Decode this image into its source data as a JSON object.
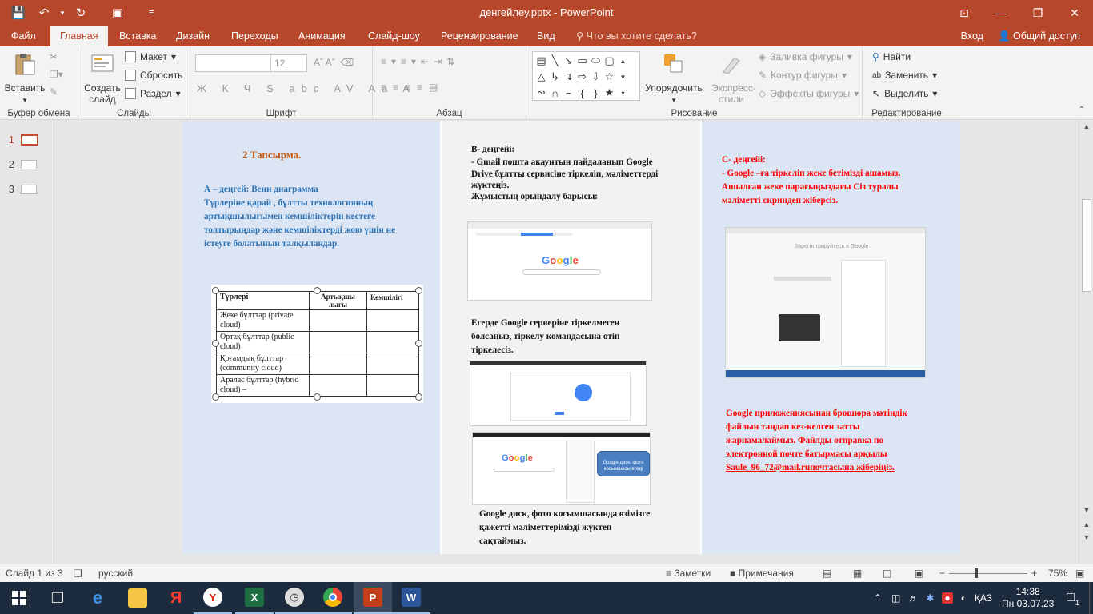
{
  "window": {
    "title": "денгейлеу.pptx - PowerPoint",
    "controls": [
      "restore-ribbon",
      "minimize",
      "restore",
      "close"
    ]
  },
  "tabs": {
    "items": [
      "Файл",
      "Главная",
      "Вставка",
      "Дизайн",
      "Переходы",
      "Анимация",
      "Слайд-шоу",
      "Рецензирование",
      "Вид"
    ],
    "active": "Главная",
    "tellme": "Что вы хотите сделать?",
    "signin": "Вход",
    "share": "Общий доступ"
  },
  "ribbon": {
    "clipboard": {
      "label": "Буфер обмена",
      "paste": "Вставить"
    },
    "slides": {
      "label": "Слайды",
      "new_slide": "Создать слайд",
      "layout": "Макет",
      "reset": "Сбросить",
      "section": "Раздел"
    },
    "font": {
      "label": "Шрифт",
      "size": "12",
      "buttons": "Ж К Ч S abc AV Aa A"
    },
    "paragraph": {
      "label": "Абзац"
    },
    "drawing": {
      "label": "Рисование",
      "arrange": "Упорядочить",
      "quick_styles": "Экспресс-стили",
      "fill": "Заливка фигуры",
      "outline": "Контур фигуры",
      "effects": "Эффекты фигуры"
    },
    "editing": {
      "label": "Редактирование",
      "find": "Найти",
      "replace": "Заменить",
      "select": "Выделить"
    }
  },
  "thumbnails": [
    "1",
    "2",
    "3"
  ],
  "slide": {
    "col_a": {
      "title": "2 Тапсырма.",
      "level": "А – деңгей:  Венн диаграмма",
      "lines": [
        "Түрлеріне қарай , бұлтты технологияның",
        "артықшылығымен кемшіліктерін кестеге",
        "толтырыңдар және кемшіліктерді жою үшін не",
        "істеуге болатынын талқыландар."
      ],
      "table": {
        "headers": [
          "Түрлері",
          "Артықшы лығы",
          "Кемшілігі"
        ],
        "rows": [
          "Жеке бұлттар (private cloud)",
          "Ортақ бұлттар (public cloud)",
          "Қоғамдық бұлттар (community cloud)",
          "Аралас бұлттар (hybrid cloud) –"
        ]
      }
    },
    "col_b": {
      "lines": [
        "В- деңгейі:",
        "- Gmail пошта акаунтын пайдаланып Google",
        "Drive бұлтты сервисіне тіркеліп, мәліметтерді",
        "жүктеңіз.",
        "Жұмыстың орындалу барысы:"
      ],
      "mid_lines": [
        "Егерде Google серверіне тіркелмеген",
        "болсаңыз, тіркелу командасына өтіп",
        "тіркелесіз."
      ],
      "bottom_lines": [
        "Google диск, фото косымшасында өзімізге",
        "қажетті мәліметтерімізді жүктеп",
        "сақтаймыз."
      ],
      "logo": "Google",
      "callout": "Google диск, фото косымшасы етеді"
    },
    "col_c": {
      "lines": [
        "С- деңгейі:",
        "- Google –ға тіркеліп жеке бетімізді ашамыз.",
        "Ашылған жеке парағыңыздағы Сіз туралы",
        "мәліметті скриндеп жіберсіз."
      ],
      "shot_title": "Зарегистрируйтесь в Google",
      "bottom_lines": [
        "Google приложениясынан брошюра мәтіндік",
        "файлын таңдап кез-келген затты",
        "жарнамалаймыз. Файлды отправка по",
        "электронной почте батырмасы арқылы",
        "Saule_96_72@mail.ruпочтасына жіберіңіз."
      ]
    }
  },
  "status": {
    "slide_info": "Слайд 1 из 3",
    "language": "русский",
    "notes": "Заметки",
    "comments": "Примечания",
    "zoom": "75%"
  },
  "taskbar": {
    "apps": [
      "start",
      "task-view",
      "edge",
      "explorer",
      "yandex-browser",
      "yandex",
      "excel",
      "clock",
      "chrome",
      "powerpoint",
      "word"
    ],
    "lang": "ҚАЗ",
    "time": "14:38",
    "date": "Пн 03.07.23",
    "notifications": "1"
  }
}
